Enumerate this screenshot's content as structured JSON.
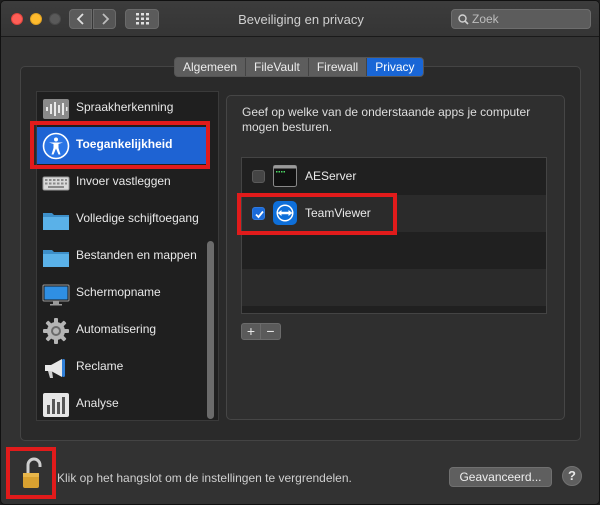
{
  "window": {
    "title": "Beveiliging en privacy"
  },
  "search": {
    "placeholder": "Zoek"
  },
  "tabs": [
    {
      "label": "Algemeen",
      "active": false
    },
    {
      "label": "FileVault",
      "active": false
    },
    {
      "label": "Firewall",
      "active": false
    },
    {
      "label": "Privacy",
      "active": true
    }
  ],
  "categories": [
    {
      "label": "Spraakherkenning",
      "icon": "waveform-icon"
    },
    {
      "label": "Toegankelijkheid",
      "icon": "accessibility-icon",
      "selected": true
    },
    {
      "label": "Invoer vastleggen",
      "icon": "keyboard-icon"
    },
    {
      "label": "Volledige schijftoegang",
      "icon": "folder-icon"
    },
    {
      "label": "Bestanden en mappen",
      "icon": "folder-icon"
    },
    {
      "label": "Schermopname",
      "icon": "display-icon"
    },
    {
      "label": "Automatisering",
      "icon": "gear-icon"
    },
    {
      "label": "Reclame",
      "icon": "megaphone-icon"
    },
    {
      "label": "Analyse",
      "icon": "bar-chart-icon"
    }
  ],
  "panel": {
    "description": "Geef op welke van de onderstaande apps je computer mogen besturen."
  },
  "apps": [
    {
      "name": "AEServer",
      "checked": false,
      "icon": "terminal-icon"
    },
    {
      "name": "TeamViewer",
      "checked": true,
      "icon": "teamviewer-icon"
    }
  ],
  "footer": {
    "lock_text": "Klik op het hangslot om de instellingen te vergrendelen.",
    "advanced_label": "Geavanceerd...",
    "help_label": "?"
  },
  "colors": {
    "accent": "#1e63d3",
    "highlight": "#e11b1b"
  }
}
